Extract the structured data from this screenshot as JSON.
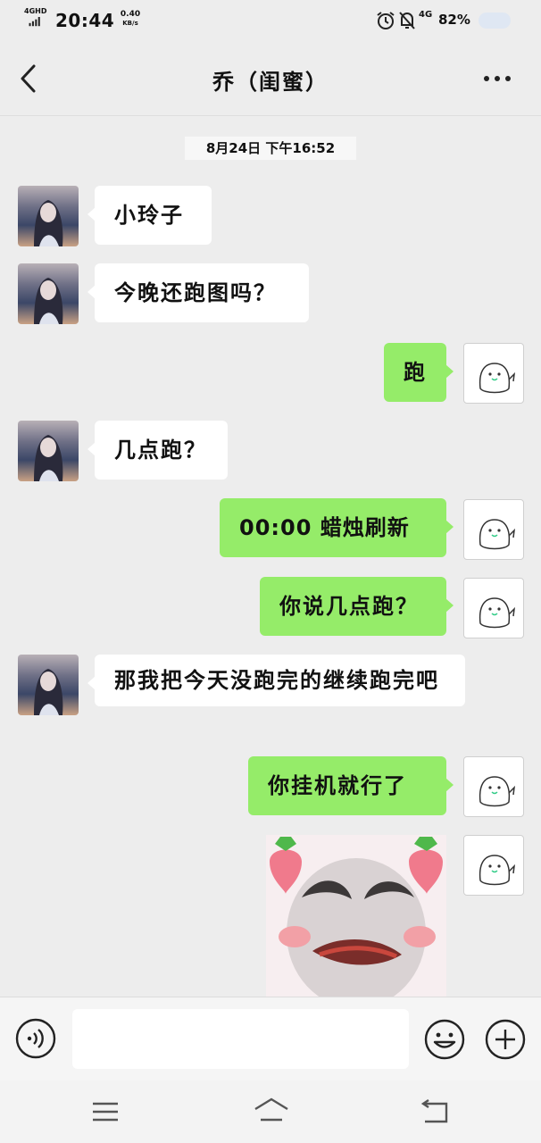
{
  "status_bar": {
    "network": "4GHD",
    "time": "20:44",
    "speed_value": "0.40",
    "speed_unit": "KB/s",
    "network2": "4G",
    "battery": "82%",
    "icons": [
      "signal-icon",
      "alarm-icon",
      "bell-off-icon",
      "battery-icon"
    ]
  },
  "nav": {
    "title": "乔（闺蜜）",
    "icons": [
      "back-arrow-icon",
      "more-icon"
    ]
  },
  "chat": {
    "timestamp": "8月24日 下午16:52",
    "messages": [
      {
        "side": "left",
        "text": "小玲子"
      },
      {
        "side": "left",
        "text": "今晚还跑图吗？"
      },
      {
        "side": "right",
        "text": "跑"
      },
      {
        "side": "left",
        "text": "几点跑？"
      },
      {
        "side": "right",
        "text": "00:00 蜡烛刷新"
      },
      {
        "side": "right",
        "text": "你说几点跑？"
      },
      {
        "side": "left",
        "text": "那我把今天没跑完的继续跑完吧"
      },
      {
        "side": "right",
        "text": "你挂机就行了"
      },
      {
        "side": "right",
        "type": "sticker",
        "text": ""
      }
    ]
  },
  "input_bar": {
    "placeholder": "",
    "icons": [
      "voice-icon",
      "emoji-icon",
      "plus-icon"
    ]
  },
  "system_nav": {
    "icons": [
      "menu-icon",
      "home-icon",
      "return-icon"
    ]
  },
  "colors": {
    "background": "#ededed",
    "bubble_self": "#95ec69",
    "bubble_other": "#ffffff"
  }
}
